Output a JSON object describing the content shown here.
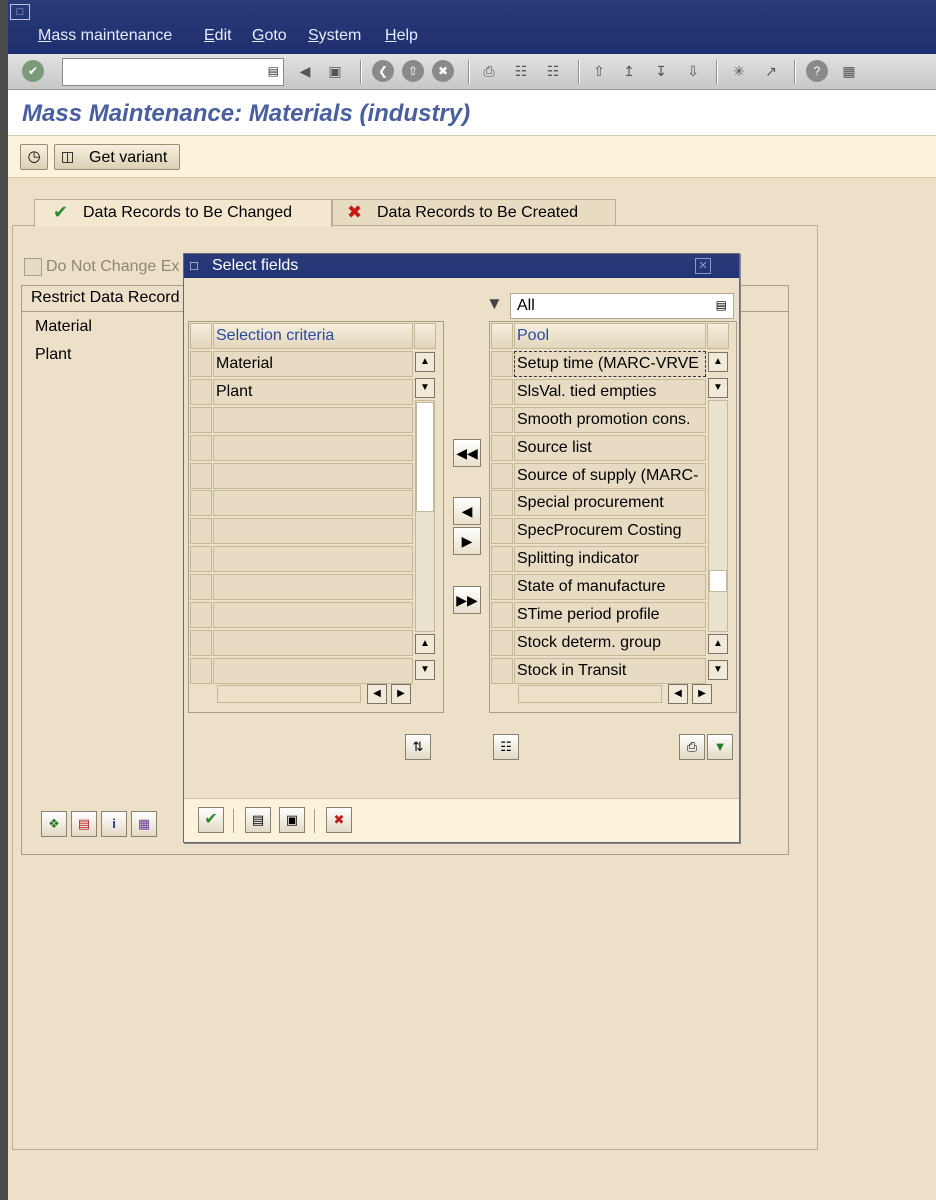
{
  "menu": {
    "items": [
      "Mass maintenance",
      "Edit",
      "Goto",
      "System",
      "Help"
    ]
  },
  "toolbar": {
    "command_value": ""
  },
  "page": {
    "title": "Mass Maintenance: Materials (industry)"
  },
  "app_toolbar": {
    "get_variant_label": "Get variant"
  },
  "tabs": [
    {
      "label": "Data Records to Be Changed",
      "icon": "check-icon",
      "active": true
    },
    {
      "label": "Data Records to Be Created",
      "icon": "x-icon",
      "active": false
    }
  ],
  "main": {
    "checkbox_label": "Do Not Change Ex",
    "restrict_header": "Restrict Data Record",
    "fields": [
      "Material",
      "Plant"
    ]
  },
  "dialog": {
    "title": "Select fields",
    "filter_value": "All",
    "left_header": "Selection criteria",
    "left_rows": [
      "Material",
      "Plant"
    ],
    "right_header": "Pool",
    "right_rows": [
      "Setup time (MARC-VRVE",
      "SlsVal. tied empties",
      "Smooth promotion cons.",
      "Source list",
      "Source of supply (MARC-",
      "Special procurement",
      "SpecProcurem Costing",
      "Splitting indicator",
      "State of manufacture",
      "STime period profile",
      "Stock determ. group",
      "Stock in Transit"
    ]
  },
  "colors": {
    "menubar": "#1f2f6e",
    "title": "#4a5fa0",
    "background": "#ece0c8",
    "header_text": "#2a4aa0"
  }
}
